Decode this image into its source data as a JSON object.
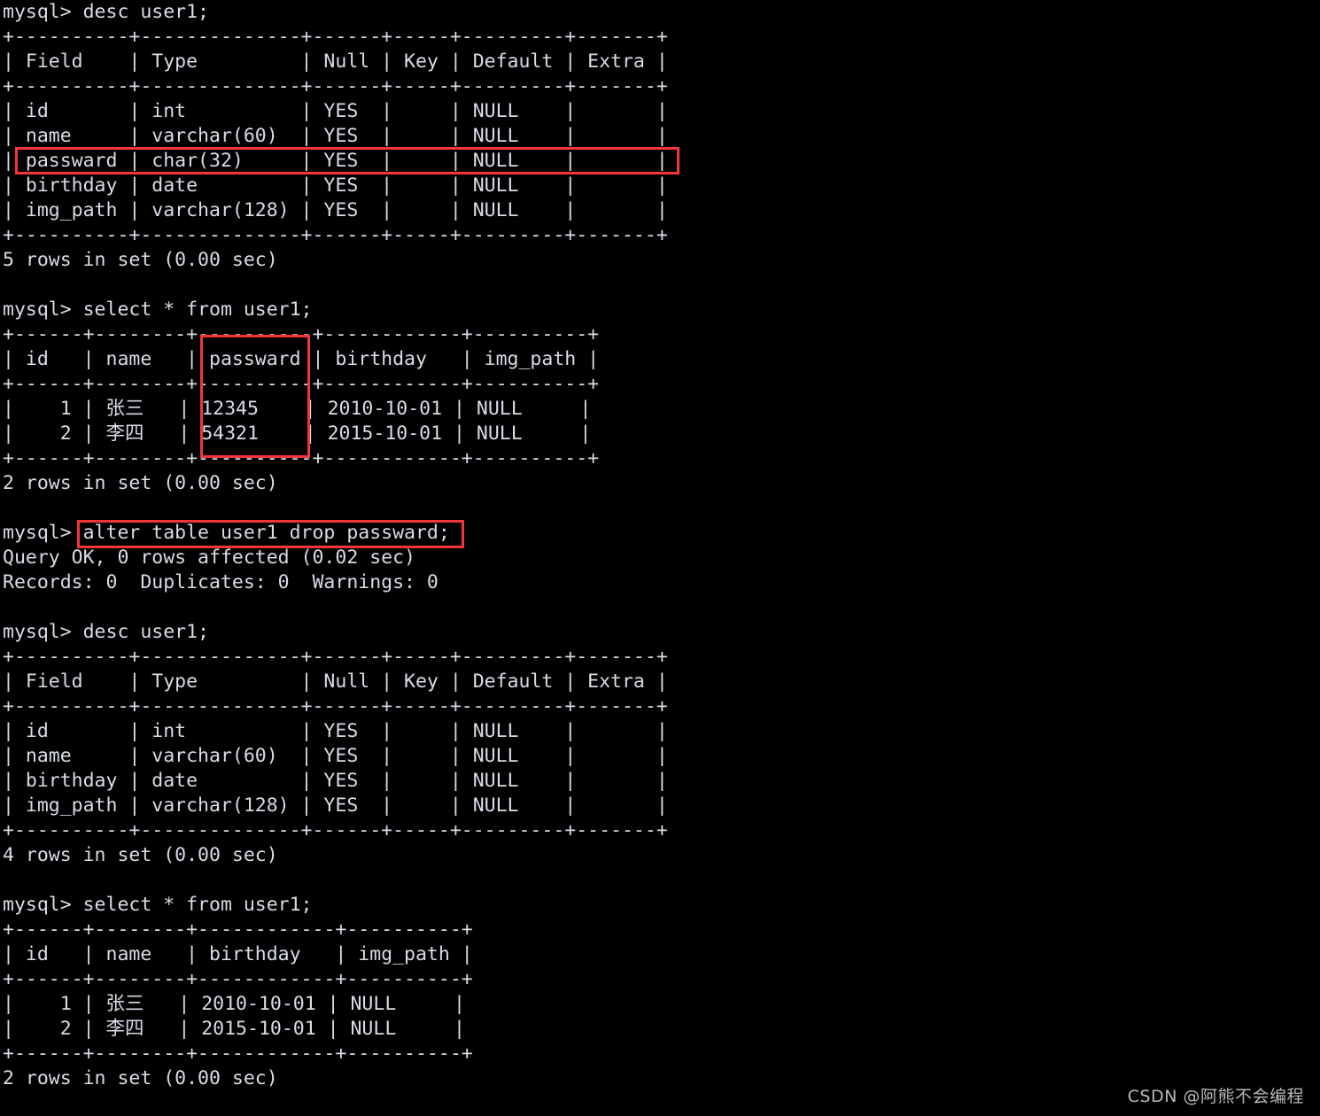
{
  "terminal": {
    "prompt": "mysql> ",
    "foreground_color": "#d8dce8",
    "background_color": "#000000",
    "highlight_color": "#f4353a",
    "lines": [
      "mysql> desc user1;",
      "+----------+--------------+------+-----+---------+-------+",
      "| Field    | Type         | Null | Key | Default | Extra |",
      "+----------+--------------+------+-----+---------+-------+",
      "| id       | int          | YES  |     | NULL    |       |",
      "| name     | varchar(60)  | YES  |     | NULL    |       |",
      "| passward | char(32)     | YES  |     | NULL    |       |",
      "| birthday | date         | YES  |     | NULL    |       |",
      "| img_path | varchar(128) | YES  |     | NULL    |       |",
      "+----------+--------------+------+-----+---------+-------+",
      "5 rows in set (0.00 sec)",
      "",
      "mysql> select * from user1;",
      "+------+--------+----------+------------+----------+",
      "| id   | name   | passward | birthday   | img_path |",
      "+------+--------+----------+------------+----------+",
      "|    1 | 张三   | 12345    | 2010-10-01 | NULL     |",
      "|    2 | 李四   | 54321    | 2015-10-01 | NULL     |",
      "+------+--------+----------+------------+----------+",
      "2 rows in set (0.00 sec)",
      "",
      "mysql> alter table user1 drop passward;",
      "Query OK, 0 rows affected (0.02 sec)",
      "Records: 0  Duplicates: 0  Warnings: 0",
      "",
      "mysql> desc user1;",
      "+----------+--------------+------+-----+---------+-------+",
      "| Field    | Type         | Null | Key | Default | Extra |",
      "+----------+--------------+------+-----+---------+-------+",
      "| id       | int          | YES  |     | NULL    |       |",
      "| name     | varchar(60)  | YES  |     | NULL    |       |",
      "| birthday | date         | YES  |     | NULL    |       |",
      "| img_path | varchar(128) | YES  |     | NULL    |       |",
      "+----------+--------------+------+-----+---------+-------+",
      "4 rows in set (0.00 sec)",
      "",
      "mysql> select * from user1;",
      "+------+--------+------------+----------+",
      "| id   | name   | birthday   | img_path |",
      "+------+--------+------------+----------+",
      "|    1 | 张三   | 2010-10-01 | NULL     |",
      "|    2 | 李四   | 2015-10-01 | NULL     |",
      "+------+--------+------------+----------+",
      "2 rows in set (0.00 sec)"
    ]
  },
  "annotations": {
    "desc_passward_row_label": "passward | char(32)     | YES  |     | NULL    |",
    "select_passward_col_label": "passward",
    "alter_statement_label": "alter table user1 drop passward;"
  },
  "watermark": {
    "text": "CSDN @阿熊不会编程"
  }
}
